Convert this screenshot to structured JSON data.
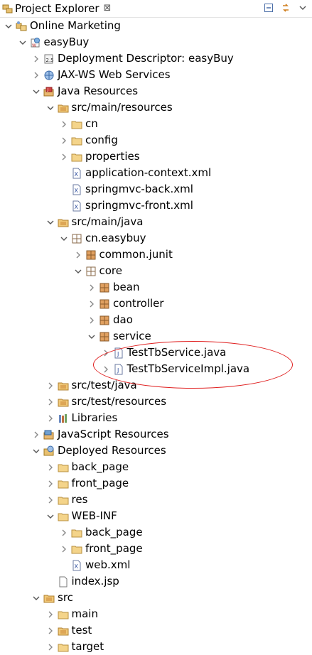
{
  "view": {
    "title": "Project Explorer",
    "close_glyph": "⊠"
  },
  "toolbar": [
    "collapse-all-icon",
    "link-with-editor-icon",
    "view-menu-icon"
  ],
  "tree": [
    {
      "label": "Online Marketing",
      "level": 0,
      "twisty": "expanded",
      "icon": "working-set"
    },
    {
      "label": "easyBuy",
      "level": 1,
      "twisty": "expanded",
      "icon": "web-project"
    },
    {
      "label": "Deployment Descriptor: easyBuy",
      "level": 2,
      "twisty": "collapsed",
      "icon": "deployment-descriptor"
    },
    {
      "label": "JAX-WS Web Services",
      "level": 2,
      "twisty": "collapsed",
      "icon": "webservices"
    },
    {
      "label": "Java Resources",
      "level": 2,
      "twisty": "expanded",
      "icon": "java-resources",
      "selected": true
    },
    {
      "label": "src/main/resources",
      "level": 3,
      "twisty": "expanded",
      "icon": "source-folder"
    },
    {
      "label": "cn",
      "level": 4,
      "twisty": "collapsed",
      "icon": "folder"
    },
    {
      "label": "config",
      "level": 4,
      "twisty": "collapsed",
      "icon": "folder"
    },
    {
      "label": "properties",
      "level": 4,
      "twisty": "collapsed",
      "icon": "folder"
    },
    {
      "label": "application-context.xml",
      "level": 4,
      "twisty": "none",
      "icon": "xml-file"
    },
    {
      "label": "springmvc-back.xml",
      "level": 4,
      "twisty": "none",
      "icon": "xml-file"
    },
    {
      "label": "springmvc-front.xml",
      "level": 4,
      "twisty": "none",
      "icon": "xml-file"
    },
    {
      "label": "src/main/java",
      "level": 3,
      "twisty": "expanded",
      "icon": "source-folder"
    },
    {
      "label": "cn.easybuy",
      "level": 4,
      "twisty": "expanded",
      "icon": "package-empty"
    },
    {
      "label": "common.junit",
      "level": 5,
      "twisty": "collapsed",
      "icon": "package"
    },
    {
      "label": "core",
      "level": 5,
      "twisty": "expanded",
      "icon": "package-empty"
    },
    {
      "label": "bean",
      "level": 6,
      "twisty": "collapsed",
      "icon": "package"
    },
    {
      "label": "controller",
      "level": 6,
      "twisty": "collapsed",
      "icon": "package"
    },
    {
      "label": "dao",
      "level": 6,
      "twisty": "collapsed",
      "icon": "package"
    },
    {
      "label": "service",
      "level": 6,
      "twisty": "expanded",
      "icon": "package"
    },
    {
      "label": "TestTbService.java",
      "level": 7,
      "twisty": "collapsed",
      "icon": "java-file"
    },
    {
      "label": "TestTbServiceImpl.java",
      "level": 7,
      "twisty": "collapsed",
      "icon": "java-file"
    },
    {
      "label": "src/test/java",
      "level": 3,
      "twisty": "collapsed",
      "icon": "source-folder"
    },
    {
      "label": "src/test/resources",
      "level": 3,
      "twisty": "collapsed",
      "icon": "source-folder"
    },
    {
      "label": "Libraries",
      "level": 3,
      "twisty": "collapsed",
      "icon": "libraries"
    },
    {
      "label": "JavaScript Resources",
      "level": 2,
      "twisty": "collapsed",
      "icon": "js-resources"
    },
    {
      "label": "Deployed Resources",
      "level": 2,
      "twisty": "expanded",
      "icon": "deployed-resources"
    },
    {
      "label": "back_page",
      "level": 3,
      "twisty": "collapsed",
      "icon": "folder"
    },
    {
      "label": "front_page",
      "level": 3,
      "twisty": "collapsed",
      "icon": "folder"
    },
    {
      "label": "res",
      "level": 3,
      "twisty": "collapsed",
      "icon": "folder"
    },
    {
      "label": "WEB-INF",
      "level": 3,
      "twisty": "expanded",
      "icon": "folder"
    },
    {
      "label": "back_page",
      "level": 4,
      "twisty": "collapsed",
      "icon": "folder"
    },
    {
      "label": "front_page",
      "level": 4,
      "twisty": "collapsed",
      "icon": "folder"
    },
    {
      "label": "web.xml",
      "level": 4,
      "twisty": "none",
      "icon": "xml-file"
    },
    {
      "label": "index.jsp",
      "level": 3,
      "twisty": "none",
      "icon": "jsp-file"
    },
    {
      "label": "src",
      "level": 2,
      "twisty": "expanded",
      "icon": "source-folder"
    },
    {
      "label": "main",
      "level": 3,
      "twisty": "collapsed",
      "icon": "folder"
    },
    {
      "label": "test",
      "level": 3,
      "twisty": "collapsed",
      "icon": "source-folder"
    },
    {
      "label": "target",
      "level": 3,
      "twisty": "collapsed",
      "icon": "folder"
    }
  ],
  "highlight": {
    "color": "#e02020"
  }
}
